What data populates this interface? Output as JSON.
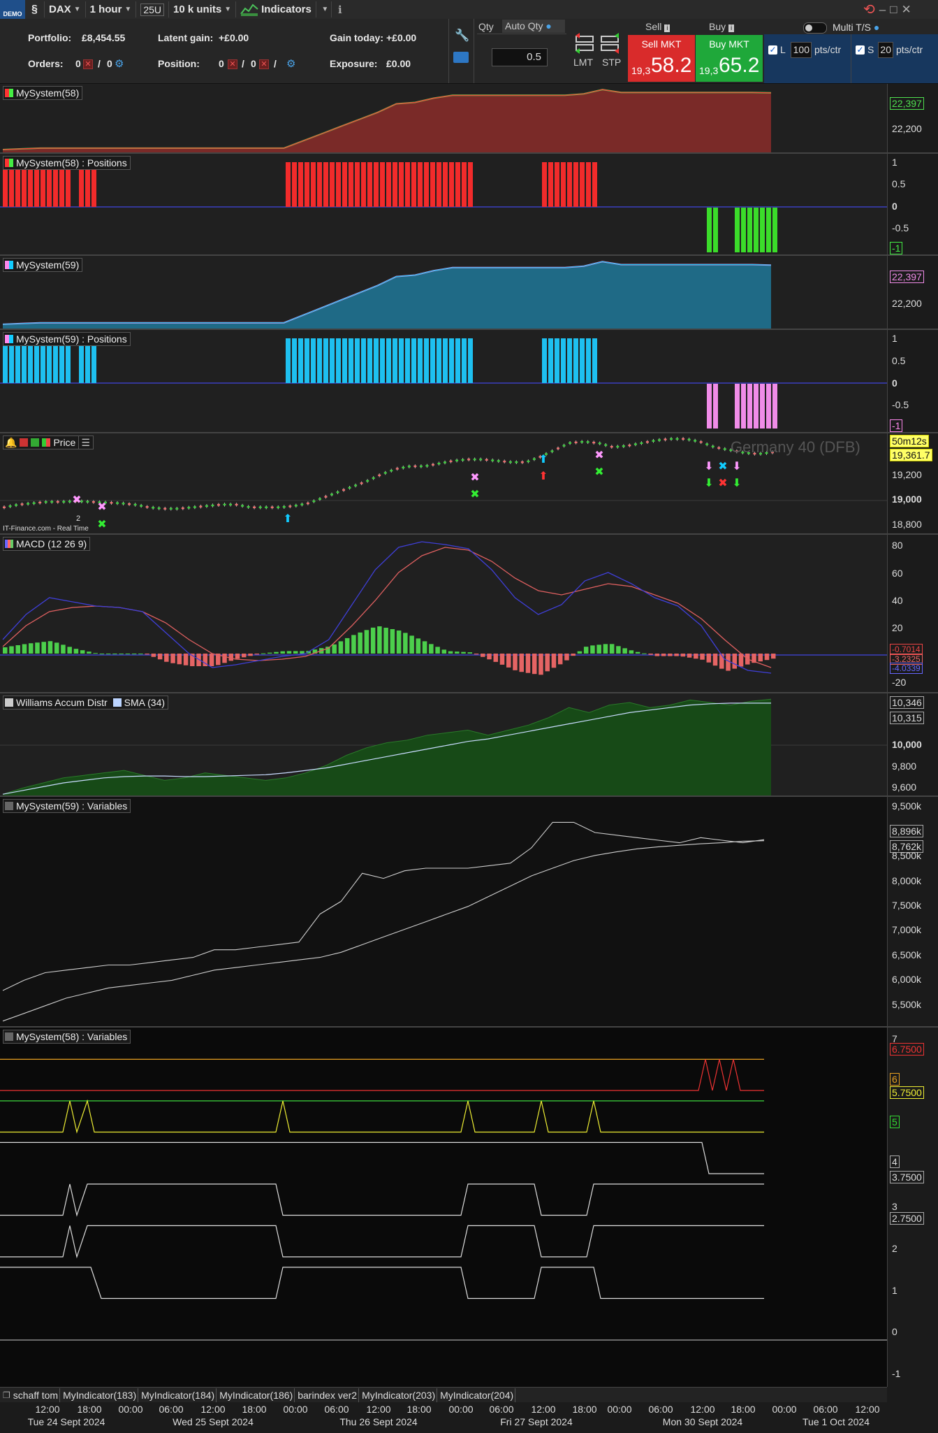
{
  "toolbar": {
    "demo_badge": "DEMO",
    "instrument": "DAX",
    "timeframe": "1 hour",
    "units_box": "25U",
    "units": "10 k units",
    "indicators": "Indicators",
    "info_icon": "info-icon"
  },
  "account": {
    "portfolio_label": "Portfolio:",
    "portfolio_value": "£8,454.55",
    "latent_label": "Latent gain:",
    "latent_value": "+£0.00",
    "gain_label": "Gain today:",
    "gain_value": "+£0.00",
    "orders_label": "Orders:",
    "orders_a": "0",
    "orders_b": "0",
    "position_label": "Position:",
    "position_a": "0",
    "position_b": "0",
    "exposure_label": "Exposure:",
    "exposure_value": "£0.00"
  },
  "order_entry": {
    "qty_label": "Qty",
    "auto_qty_label": "Auto Qty",
    "qty_value": "0.5",
    "lmt_label": "LMT",
    "stp_label": "STP",
    "sell_header": "Sell",
    "buy_header": "Buy",
    "sell_button": "Sell MKT",
    "buy_button": "Buy MKT",
    "sell_price_small": "19,3",
    "sell_price_big": "58.2",
    "buy_price_small": "19,3",
    "buy_price_big": "65.2",
    "multi_ts": "Multi T/S",
    "long_label": "L",
    "long_value": "100",
    "long_unit": "pts/ctr",
    "short_label": "S",
    "short_value": "20",
    "short_unit": "pts/ctr"
  },
  "panels": {
    "equity58": {
      "title": "MySystem(58)",
      "last": "22,397",
      "tick": "22,200"
    },
    "pos58": {
      "title": "MySystem(58) : Positions",
      "ticks": [
        "1",
        "0.5",
        "0",
        "-0.5",
        "-1"
      ]
    },
    "equity59": {
      "title": "MySystem(59)",
      "last": "22,397",
      "tick": "22,200"
    },
    "pos59": {
      "title": "MySystem(59) : Positions",
      "ticks": [
        "1",
        "0.5",
        "0",
        "-0.5",
        "-1"
      ]
    },
    "price": {
      "title": "Price",
      "watermark": "Germany 40 (DFB)",
      "countdown": "50m12s",
      "last": "19,361.7",
      "ticks": [
        "19,200",
        "19,000",
        "18,800"
      ],
      "source": "IT-Finance.com - Real Time",
      "marker_2": "2"
    },
    "macd": {
      "title": "MACD (12 26 9)",
      "ticks": [
        "80",
        "60",
        "40",
        "20",
        "-20"
      ],
      "tag1": "-0.7014",
      "tag2": "-3.2325",
      "tag3": "-4.0339"
    },
    "williams": {
      "title": "Williams Accum Distr",
      "sma_title": "SMA (34)",
      "ticks": [
        "10,346",
        "10,315",
        "10,000",
        "9,800",
        "9,600"
      ]
    },
    "vars59": {
      "title": "MySystem(59) : Variables",
      "ticks": [
        "9,500k",
        "8,896k",
        "8,762k",
        "8,500k",
        "8,000k",
        "7,500k",
        "7,000k",
        "6,500k",
        "6,000k",
        "5,500k"
      ]
    },
    "vars58": {
      "title": "MySystem(58) : Variables",
      "ticks": [
        "7",
        "6.7500",
        "6",
        "5.7500",
        "5",
        "4",
        "3.7500",
        "3",
        "2.7500",
        "2",
        "1",
        "0",
        "-1"
      ]
    }
  },
  "bottom_tabs": [
    "schaff tom",
    "MyIndicator(183)",
    "MyIndicator(184)",
    "MyIndicator(186)",
    "barindex ver2",
    "MyIndicator(203)",
    "MyIndicator(204)"
  ],
  "time_axis": {
    "times": [
      "12:00",
      "18:00",
      "00:00",
      "06:00",
      "12:00",
      "18:00",
      "00:00",
      "06:00",
      "12:00",
      "18:00",
      "00:00",
      "06:00",
      "12:00",
      "18:00",
      "00:00",
      "06:00",
      "12:00",
      "18:00",
      "00:00",
      "06:00",
      "12:00"
    ],
    "dates": [
      "Tue 24 Sept 2024",
      "Wed 25 Sept 2024",
      "Thu 26 Sept 2024",
      "Fri 27 Sept 2024",
      "Mon 30 Sept 2024",
      "Tue 1 Oct 2024"
    ]
  },
  "colors": {
    "sell": "#d92b2b",
    "buy": "#1fa83a",
    "red_bar": "#f22b2b",
    "green_bar": "#3bdc2a",
    "cyan_bar": "#1ec0f0",
    "pink_bar": "#f08ce8"
  },
  "chart_data": [
    {
      "type": "area",
      "title": "MySystem(58)",
      "values": [
        22000,
        22005,
        22010,
        22010,
        22010,
        22010,
        22010,
        22010,
        22010,
        22010,
        22010,
        22010,
        22010,
        22010,
        22010,
        22010,
        22060,
        22110,
        22160,
        22210,
        22260,
        22320,
        22330,
        22360,
        22380,
        22380,
        22380,
        22380,
        22380,
        22380,
        22380,
        22390,
        22420,
        22400,
        22400,
        22400,
        22400,
        22400,
        22400,
        22400,
        22400,
        22397
      ]
    },
    {
      "type": "bar",
      "title": "MySystem(58) : Positions",
      "ylim": [
        -1,
        1
      ]
    },
    {
      "type": "area",
      "title": "MySystem(59)",
      "values": [
        22000,
        22005,
        22010,
        22010,
        22010,
        22010,
        22010,
        22010,
        22010,
        22010,
        22010,
        22010,
        22010,
        22010,
        22010,
        22010,
        22060,
        22110,
        22160,
        22210,
        22260,
        22320,
        22330,
        22360,
        22380,
        22380,
        22380,
        22380,
        22380,
        22380,
        22380,
        22390,
        22420,
        22400,
        22400,
        22400,
        22400,
        22400,
        22400,
        22400,
        22400,
        22397
      ]
    },
    {
      "type": "bar",
      "title": "MySystem(59) : Positions",
      "ylim": [
        -1,
        1
      ]
    },
    {
      "type": "line",
      "title": "Price",
      "values": [
        18960,
        18980,
        18990,
        19000,
        19000,
        19005,
        19000,
        18995,
        18990,
        18980,
        18960,
        18950,
        18950,
        18960,
        18970,
        18980,
        18980,
        18960,
        18960,
        18960,
        18970,
        18990,
        19030,
        19070,
        19110,
        19150,
        19200,
        19240,
        19260,
        19260,
        19280,
        19300,
        19310,
        19310,
        19300,
        19290,
        19290,
        19330,
        19380,
        19430,
        19440,
        19430,
        19400,
        19410,
        19430,
        19450,
        19460,
        19460,
        19440,
        19400,
        19380,
        19360,
        19350,
        19362
      ]
    },
    {
      "type": "bar",
      "title": "MACD (12 26 9)",
      "ylim": [
        -20,
        80
      ]
    },
    {
      "type": "area",
      "title": "Williams Accum Distr",
      "ylim": [
        9600,
        10346
      ]
    },
    {
      "type": "line",
      "title": "MySystem(59) : Variables",
      "ylim": [
        5500,
        9500
      ]
    },
    {
      "type": "line",
      "title": "MySystem(58) : Variables",
      "ylim": [
        -1,
        7
      ]
    }
  ]
}
